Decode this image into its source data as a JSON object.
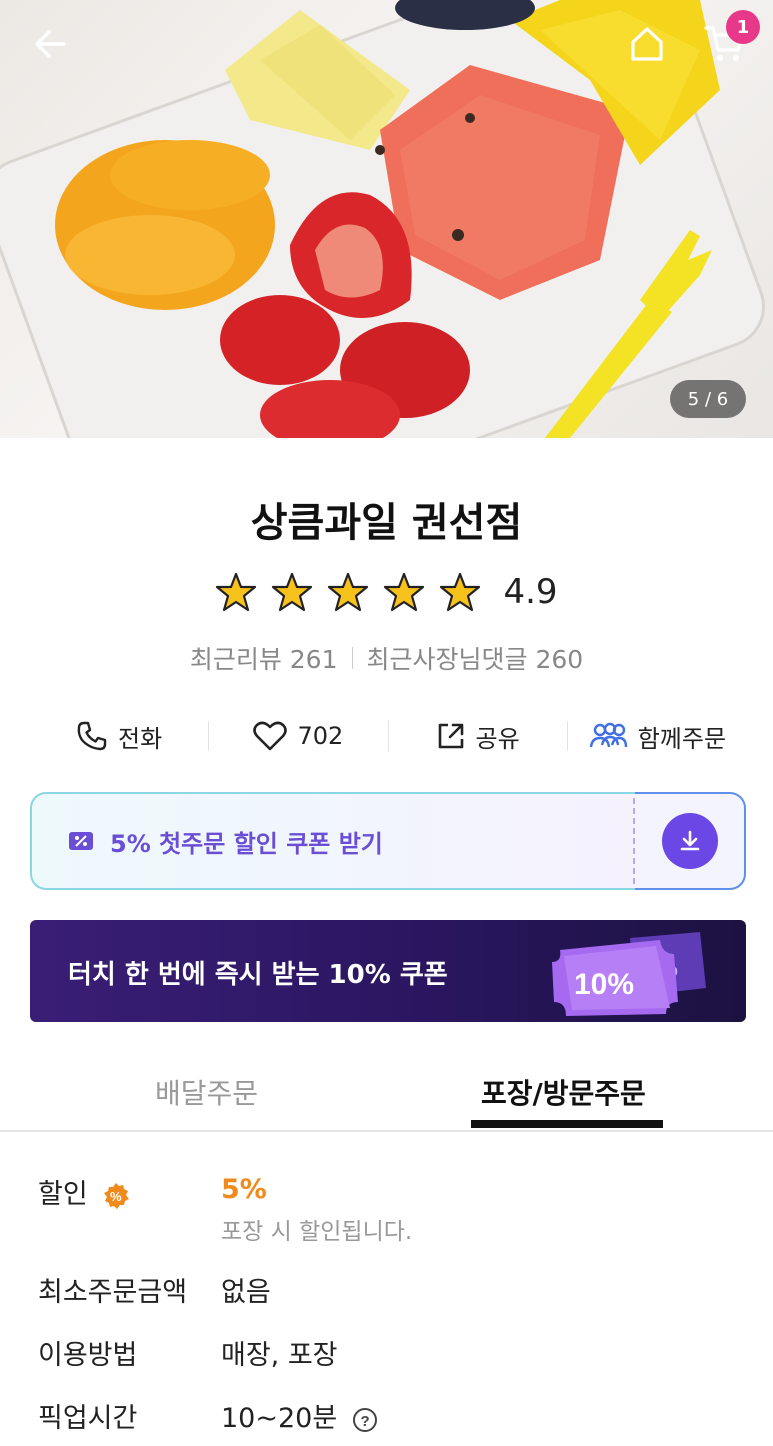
{
  "header": {
    "cart_count": "1",
    "photo_counter": "5 / 6"
  },
  "store": {
    "name": "상큼과일 권선점",
    "rating": "4.9",
    "stars_filled": 5,
    "recent_reviews": "최근리뷰 261",
    "owner_replies": "최근사장님댓글 260"
  },
  "actions": [
    {
      "label": "전화",
      "icon": "phone-icon"
    },
    {
      "label": "702",
      "icon": "heart-icon"
    },
    {
      "label": "공유",
      "icon": "share-icon"
    },
    {
      "label": "함께주문",
      "icon": "group-icon"
    }
  ],
  "coupon": {
    "label": "5% 첫주문 할인 쿠폰 받기",
    "icon": "coupon-icon",
    "download_icon": "download-icon"
  },
  "banner": {
    "text": "터치 한 번에 즉시 받는 10% 쿠폰",
    "ticket_label": "10%"
  },
  "tabs": {
    "delivery": "배달주문",
    "pickup": "포장/방문주문",
    "active": "pickup"
  },
  "info": {
    "discount_label": "할인",
    "discount_value": "5%",
    "discount_note": "포장 시 할인됩니다.",
    "min_order_label": "최소주문금액",
    "min_order_value": "없음",
    "usage_label": "이용방법",
    "usage_value": "매장, 포장",
    "pickup_time_label": "픽업시간",
    "pickup_time_value": "10~20분"
  },
  "colors": {
    "accent_purple": "#6b48e6",
    "discount_orange": "#f08a1c",
    "badge_pink": "#e8388a",
    "star_yellow": "#f7c21c"
  }
}
